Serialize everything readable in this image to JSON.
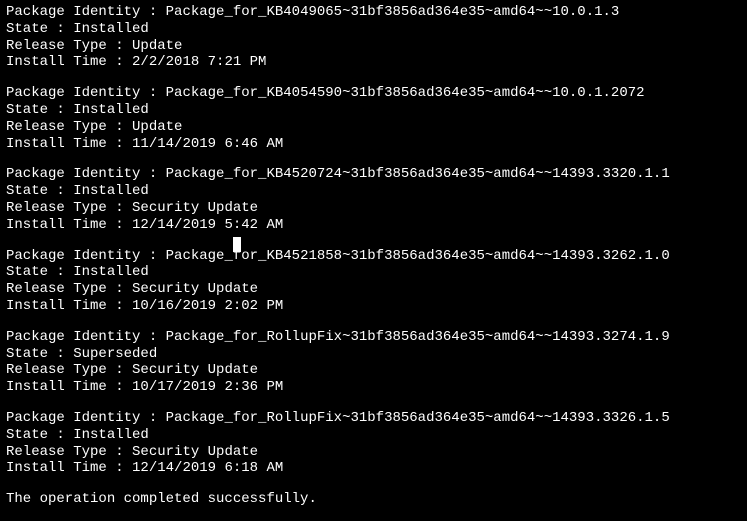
{
  "labels": {
    "identity": "Package Identity : ",
    "state": "State : ",
    "release": "Release Type : ",
    "install": "Install Time : "
  },
  "packages": [
    {
      "identity": "Package_for_KB4049065~31bf3856ad364e35~amd64~~10.0.1.3",
      "state": "Installed",
      "release": "Update",
      "install": "2/2/2018 7:21 PM"
    },
    {
      "identity": "Package_for_KB4054590~31bf3856ad364e35~amd64~~10.0.1.2072",
      "state": "Installed",
      "release": "Update",
      "install": "11/14/2019 6:46 AM"
    },
    {
      "identity": "Package_for_KB4520724~31bf3856ad364e35~amd64~~14393.3320.1.1",
      "state": "Installed",
      "release": "Security Update",
      "install": "12/14/2019 5:42 AM"
    },
    {
      "identity": "Package_for_KB4521858~31bf3856ad364e35~amd64~~14393.3262.1.0",
      "state": "Installed",
      "release": "Security Update",
      "install": "10/16/2019 2:02 PM"
    },
    {
      "identity": "Package_for_RollupFix~31bf3856ad364e35~amd64~~14393.3274.1.9",
      "state": "Superseded",
      "release": "Security Update",
      "install": "10/17/2019 2:36 PM"
    },
    {
      "identity": "Package_for_RollupFix~31bf3856ad364e35~amd64~~14393.3326.1.5",
      "state": "Installed",
      "release": "Security Update",
      "install": "12/14/2019 6:18 AM"
    }
  ],
  "footer": "The operation completed successfully."
}
